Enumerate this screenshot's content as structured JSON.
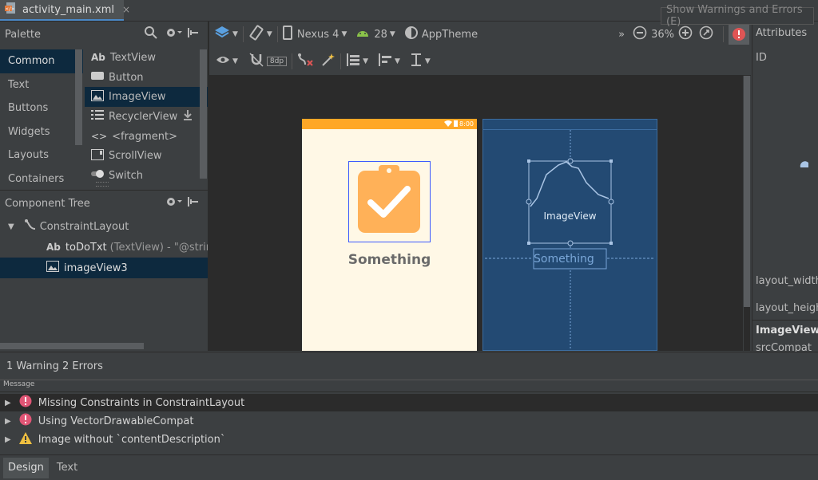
{
  "file_tab": {
    "name": "activity_main.xml",
    "close": "×"
  },
  "tooltip": "Show Warnings and Errors (E)",
  "palette": {
    "title": "Palette",
    "categories": [
      "Common",
      "Text",
      "Buttons",
      "Widgets",
      "Layouts",
      "Containers"
    ],
    "selected_category": "Common",
    "items": [
      {
        "icon": "Ab",
        "label": "TextView"
      },
      {
        "icon": "button-icon",
        "label": "Button"
      },
      {
        "icon": "image-icon",
        "label": "ImageView"
      },
      {
        "icon": "list-icon",
        "label": "RecyclerView"
      },
      {
        "icon": "<>",
        "label": "<fragment>"
      },
      {
        "icon": "scroll-icon",
        "label": "ScrollView"
      },
      {
        "icon": "switch-icon",
        "label": "Switch"
      }
    ],
    "selected_item": "ImageView"
  },
  "component_tree": {
    "title": "Component Tree",
    "root": "ConstraintLayout",
    "child1_name": "toDoTxt",
    "child1_detail": "(TextView) - \"@string",
    "child2_name": "imageView3"
  },
  "toolbar": {
    "device": "Nexus 4",
    "api": "28",
    "theme": "AppTheme",
    "zoom": "36%",
    "more": "»",
    "margin": "8dp"
  },
  "design": {
    "status_time": "8:00",
    "text_label": "Something",
    "blueprint_image_label": "ImageView",
    "blueprint_text_label": "Something"
  },
  "attributes": {
    "title": "Attributes",
    "id_label": "ID",
    "layout_width": "layout_width",
    "layout_height": "layout_heigh",
    "section": "ImageView",
    "src": "srcCompat"
  },
  "problems": {
    "summary": "1 Warning 2 Errors",
    "column": "Message",
    "rows": [
      {
        "type": "error",
        "text": "Missing Constraints in ConstraintLayout"
      },
      {
        "type": "error",
        "text": "Using VectorDrawableCompat"
      },
      {
        "type": "warning",
        "text": "Image without `contentDescription`"
      }
    ]
  },
  "bottom_tabs": [
    "Design",
    "Text"
  ],
  "colors": {
    "accent": "#ffa726",
    "blueprint": "#234a73",
    "error": "#e05555",
    "warning": "#f0c040",
    "selection": "#0d293e"
  }
}
